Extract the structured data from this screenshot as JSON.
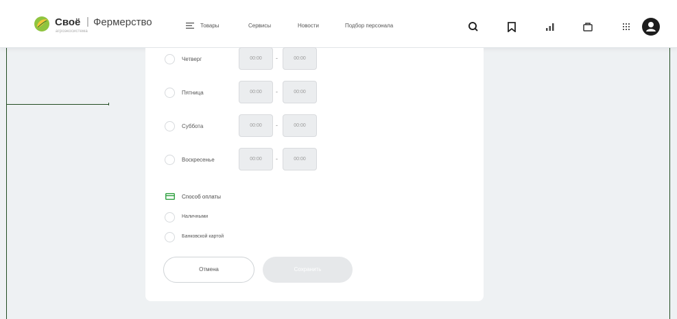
{
  "header": {
    "brand": "Своё",
    "separator": "|",
    "subbrand": "Фермерство",
    "tagline": "агроэкосистема",
    "nav": {
      "goods": "Товары",
      "services": "Сервисы",
      "news": "Новости",
      "staff": "Подбор персонала"
    }
  },
  "schedule": {
    "days": [
      {
        "label": "Четверг",
        "from": "00:00",
        "to": "00:00"
      },
      {
        "label": "Пятница",
        "from": "00:00",
        "to": "00:00"
      },
      {
        "label": "Суббота",
        "from": "00:00",
        "to": "00:00"
      },
      {
        "label": "Воскресенье",
        "from": "00:00",
        "to": "00:00"
      }
    ],
    "dash": "-"
  },
  "payment": {
    "title": "Способ оплаты",
    "options": [
      "Наличными",
      "Банковской картой"
    ]
  },
  "actions": {
    "cancel": "Отмена",
    "save": "Сохранить"
  },
  "colors": {
    "accent_green": "#3aa54a",
    "frame_line": "#1f4a1f",
    "background": "#eef1f3"
  },
  "icons": [
    "logo-leaf-icon",
    "menu-icon",
    "search-icon",
    "bookmark-icon",
    "chart-icon",
    "cart-icon",
    "grid-icon",
    "user-icon",
    "card-icon"
  ]
}
